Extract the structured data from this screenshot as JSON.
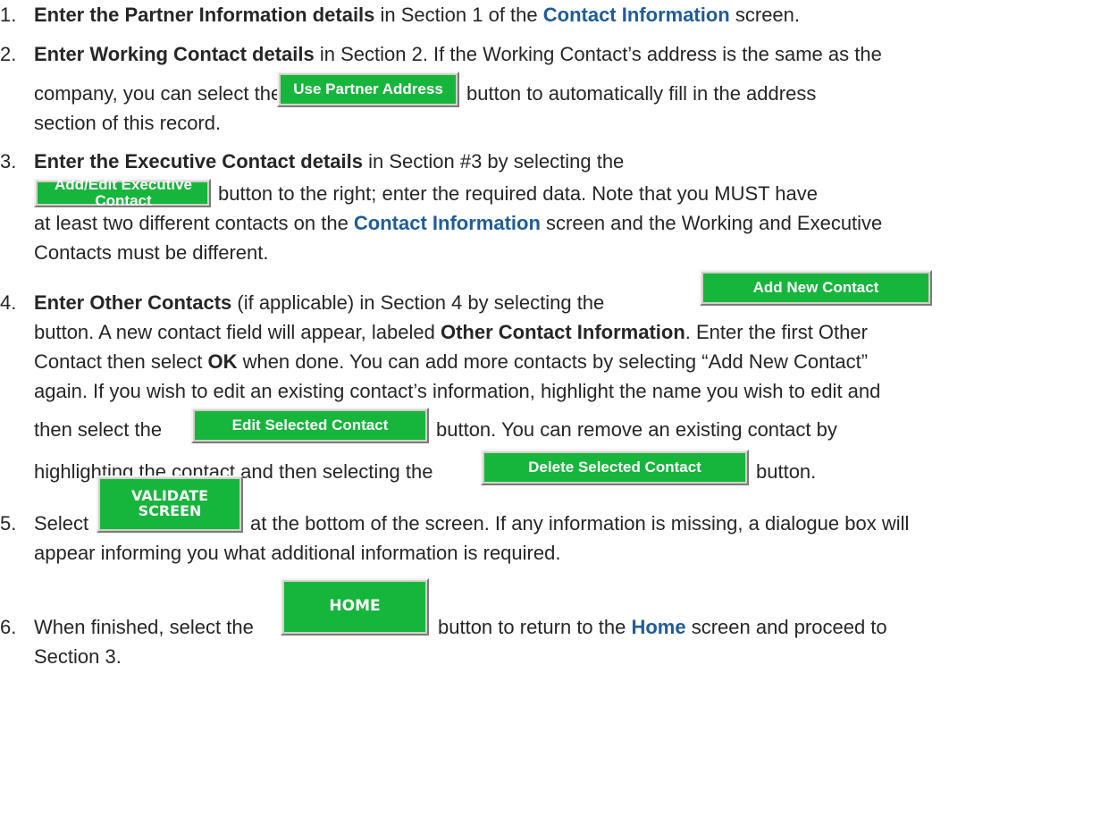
{
  "step1": {
    "num": "1.",
    "bold": "Enter the Partner Information details",
    "t1": " in Section 1 of the ",
    "link": "Contact Information",
    "t2": " screen."
  },
  "step2": {
    "num": "2.",
    "bold": "Enter Working Contact details",
    "t1": " in Section 2.   If the Working Contact’s address is the same as the",
    "t2": "company, you can select the",
    "button": "Use Partner Address",
    "t3": "button to automatically fill in the address",
    "t4": "section of this record."
  },
  "step3": {
    "num": "3.",
    "bold": "Enter the Executive Contact details",
    "t1": " in Section #3 by selecting the",
    "button": "Add/Edit Executive Contact",
    "t2": "button to the right; enter the required data. Note that you MUST have",
    "t3": "at least two different contacts on the ",
    "link": "Contact Information",
    "t4": " screen and the Working and Executive",
    "t5": "Contacts must be different."
  },
  "step4": {
    "num": "4.",
    "bold": "Enter Other Contacts",
    "t1": " (if applicable) in Section 4 by selecting the",
    "button_add": "Add New Contact",
    "t2a": "button. A new contact field will appear, labeled ",
    "bold2": "Other Contact Information",
    "t2b": ". Enter the first Other",
    "t3a": "Contact then select ",
    "ok": "OK",
    "t3b": " when done.   You can add more contacts by selecting “Add New Contact”",
    "t4": "again.  If you wish to edit an existing contact’s information, highlight the name you wish to edit and",
    "t5a": "then select the",
    "button_edit": "Edit Selected Contact",
    "t5b": "button. You can remove an existing contact by",
    "t6a": "highlighting the contact and then selecting the",
    "button_delete": "Delete Selected Contact",
    "t6b": "button."
  },
  "step5": {
    "num": "5.",
    "t1": "Select",
    "button_line1": "VALIDATE",
    "button_line2": "SCREEN",
    "t2": "at the bottom of the screen.  If any information is missing, a dialogue box will",
    "t3": "appear informing you what additional information is required."
  },
  "step6": {
    "num": "6.",
    "t1": "When finished, select the",
    "button": "HOME",
    "t2a": "button to return to the ",
    "link": "Home",
    "t2b": " screen and proceed to",
    "t3": "Section 3."
  },
  "colors": {
    "button_green": "#16b53c",
    "link_blue": "#1f5c99"
  }
}
